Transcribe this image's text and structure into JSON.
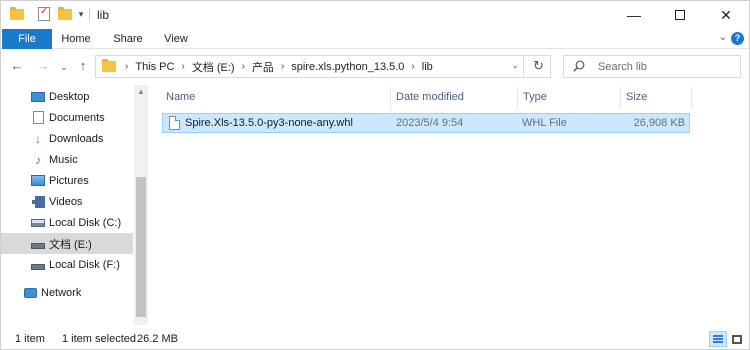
{
  "window": {
    "title": "lib",
    "controls": {
      "minimize": "—",
      "close": "✕"
    }
  },
  "ribbon": {
    "tabs": [
      {
        "label": "File"
      },
      {
        "label": "Home"
      },
      {
        "label": "Share"
      },
      {
        "label": "View"
      }
    ],
    "help_label": "?"
  },
  "navigation": {
    "breadcrumbs": [
      "This PC",
      "文档 (E:)",
      "产品",
      "spire.xls.python_13.5.0",
      "lib"
    ],
    "search_placeholder": "Search lib"
  },
  "sidebar": {
    "items": [
      {
        "label": "Desktop",
        "icon": "desktop-icon",
        "selected": false
      },
      {
        "label": "Documents",
        "icon": "documents-icon",
        "selected": false
      },
      {
        "label": "Downloads",
        "icon": "downloads-icon",
        "selected": false
      },
      {
        "label": "Music",
        "icon": "music-icon",
        "selected": false
      },
      {
        "label": "Pictures",
        "icon": "pictures-icon",
        "selected": false
      },
      {
        "label": "Videos",
        "icon": "videos-icon",
        "selected": false
      },
      {
        "label": "Local Disk (C:)",
        "icon": "drive-icon",
        "selected": false
      },
      {
        "label": "文档 (E:)",
        "icon": "drive-icon",
        "selected": true
      },
      {
        "label": "Local Disk (F:)",
        "icon": "drive-icon",
        "selected": false
      },
      {
        "label": "Network",
        "icon": "network-icon",
        "selected": false
      }
    ]
  },
  "file_list": {
    "columns": [
      "Name",
      "Date modified",
      "Type",
      "Size"
    ],
    "rows": [
      {
        "name": "Spire.Xls-13.5.0-py3-none-any.whl",
        "date_modified": "2023/5/4 9:54",
        "type": "WHL File",
        "size": "26,908 KB",
        "selected": true
      }
    ]
  },
  "status_bar": {
    "item_count": "1 item",
    "selection": "1 item selected",
    "selection_size": "26.2 MB"
  },
  "colors": {
    "accent": "#1979ca",
    "selection_bg": "#cce8ff",
    "selection_border": "#99d1ff",
    "header_text": "#4c607a"
  }
}
